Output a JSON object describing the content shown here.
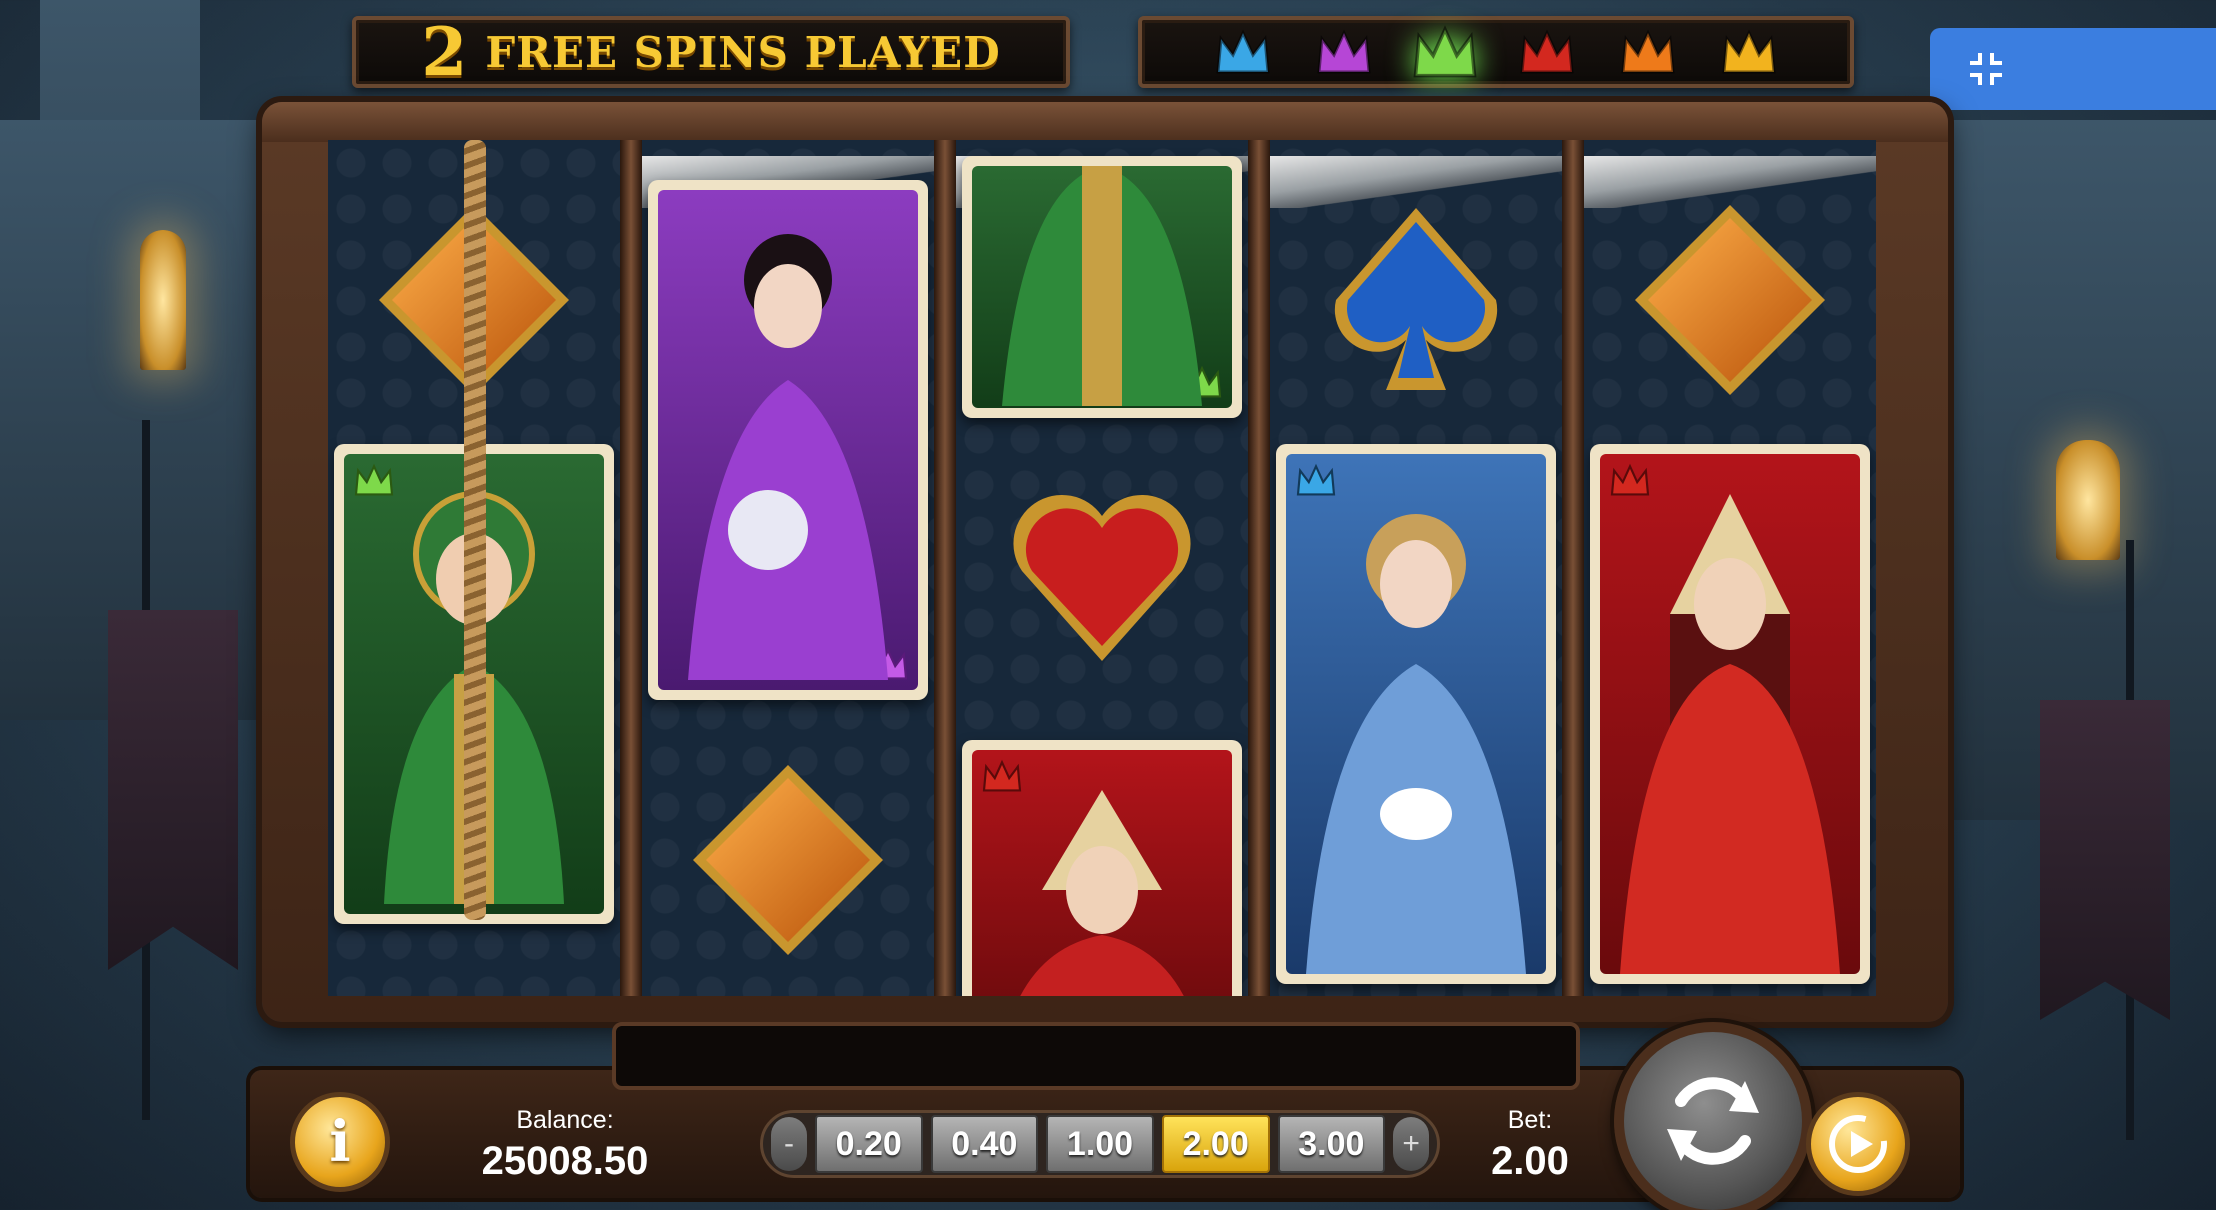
{
  "header": {
    "free_spins_count": "2",
    "free_spins_text": "FREE SPINS PLAYED",
    "crowns": [
      {
        "name": "blue-crown",
        "color": "#3aa7e6",
        "active": false
      },
      {
        "name": "purple-crown",
        "color": "#b646d6",
        "active": false
      },
      {
        "name": "green-crown",
        "color": "#7ed94a",
        "active": true
      },
      {
        "name": "red-crown",
        "color": "#d3281f",
        "active": false
      },
      {
        "name": "orange-crown",
        "color": "#ee7a1a",
        "active": false
      },
      {
        "name": "gold-crown",
        "color": "#f2b31e",
        "active": false
      }
    ]
  },
  "icons": {
    "fullscreen": "exit-fullscreen-icon",
    "info": "info-icon",
    "spin": "spin-icon",
    "autoplay": "autoplay-icon"
  },
  "info_label": "i",
  "balance": {
    "label": "Balance:",
    "value": "25008.50"
  },
  "bet": {
    "minus": "-",
    "plus": "+",
    "options": [
      "0.20",
      "0.40",
      "1.00",
      "2.00",
      "3.00"
    ],
    "selected": "2.00",
    "label": "Bet:",
    "value": "2.00"
  },
  "reels": [
    [
      "orange-diamond",
      "green-queen"
    ],
    [
      "purple-queen",
      "orange-diamond"
    ],
    [
      "green-queen",
      "red-heart",
      "red-queen"
    ],
    [
      "blue-spade",
      "blue-queen"
    ],
    [
      "orange-diamond",
      "red-queen"
    ]
  ],
  "colors": {
    "header_text": "#f7c934",
    "selected_bet": "#f0c020",
    "fullscreen_button": "#3b7ee0"
  }
}
